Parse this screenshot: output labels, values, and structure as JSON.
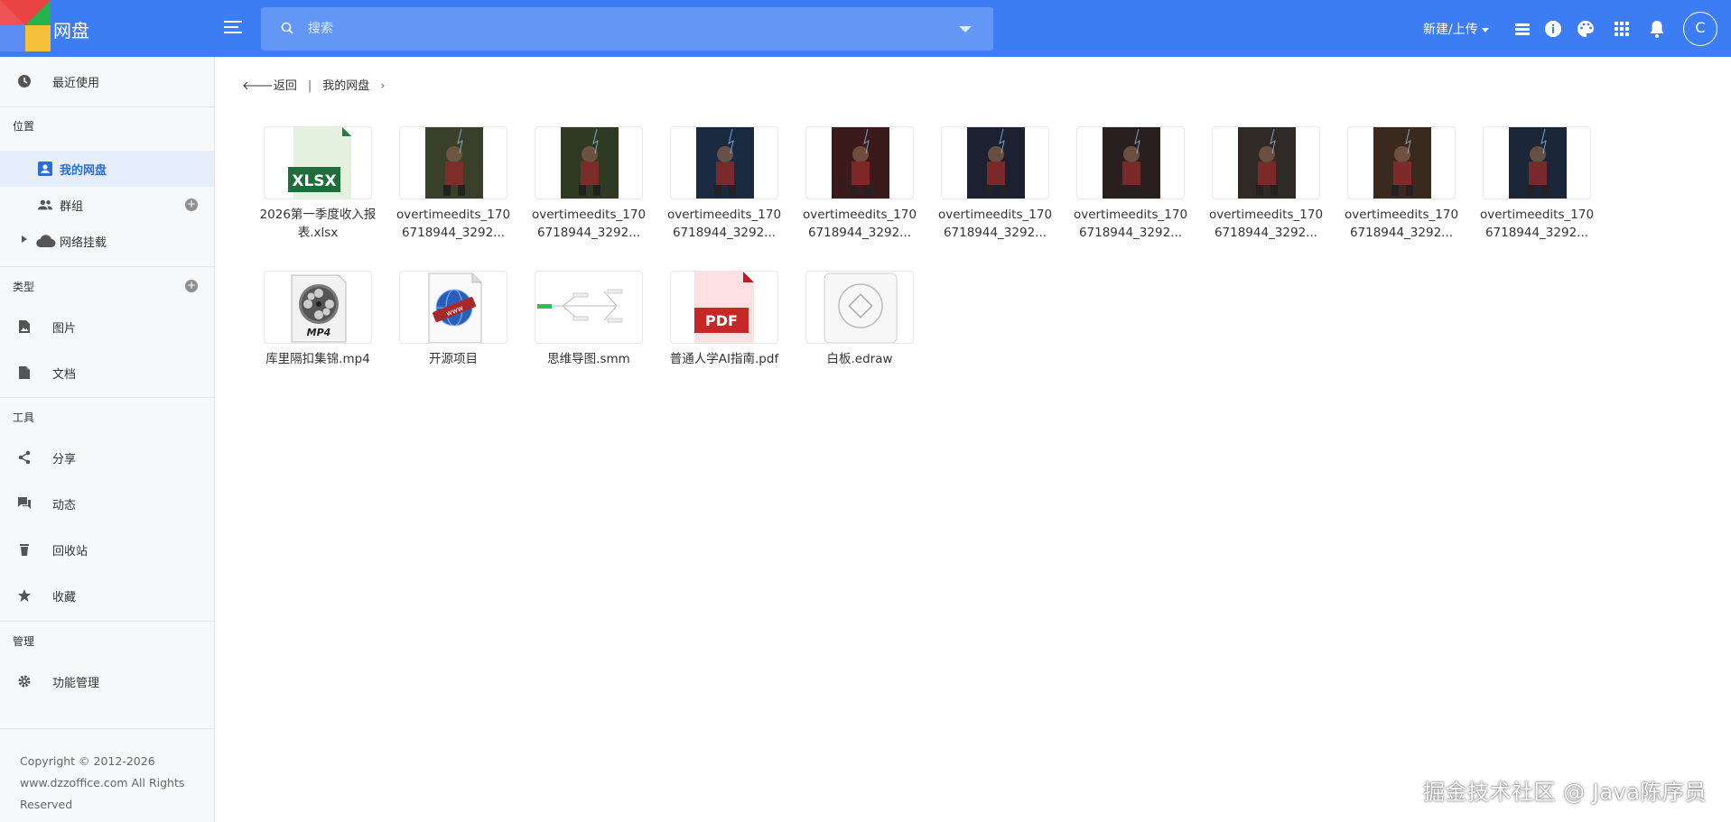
{
  "header": {
    "app_title": "网盘",
    "search_placeholder": "搜索",
    "new_upload_label": "新建/上传",
    "avatar_letter": "C",
    "accent": "#3d7df4"
  },
  "sidebar": {
    "recent": "最近使用",
    "section_location": "位置",
    "my_drive": "我的网盘",
    "groups": "群组",
    "network_mount": "网络挂载",
    "section_type": "类型",
    "images": "图片",
    "documents": "文档",
    "section_tools": "工具",
    "share": "分享",
    "activity": "动态",
    "recycle": "回收站",
    "favorites": "收藏",
    "section_admin": "管理",
    "feature_mgmt": "功能管理",
    "copyright": "Copyright © 2012-2026 www.dzzoffice.com All Rights Reserved"
  },
  "breadcrumb": {
    "back": "返回",
    "sep": "|",
    "current": "我的网盘"
  },
  "files": [
    {
      "name": "2026第一季度收入报表.xlsx",
      "type": "xlsx"
    },
    {
      "name": "overtimeedits_1706718944_3292...",
      "type": "image",
      "color": "#3a3f2a"
    },
    {
      "name": "overtimeedits_1706718944_3292...",
      "type": "image",
      "color": "#2e3a22"
    },
    {
      "name": "overtimeedits_1706718944_3292...",
      "type": "image",
      "color": "#1a2a40"
    },
    {
      "name": "overtimeedits_1706718944_3292...",
      "type": "image",
      "color": "#3a1a1a"
    },
    {
      "name": "overtimeedits_1706718944_3292...",
      "type": "image",
      "color": "#1d2030"
    },
    {
      "name": "overtimeedits_1706718944_3292...",
      "type": "image",
      "color": "#2a1f1f"
    },
    {
      "name": "overtimeedits_1706718944_3292...",
      "type": "image",
      "color": "#2f2a26"
    },
    {
      "name": "overtimeedits_1706718944_3292...",
      "type": "image",
      "color": "#3a2a1e"
    },
    {
      "name": "overtimeedits_1706718944_3292...",
      "type": "image",
      "color": "#1b2638"
    },
    {
      "name": "库里隔扣集锦.mp4",
      "type": "mp4"
    },
    {
      "name": "开源项目",
      "type": "link"
    },
    {
      "name": "思维导图.smm",
      "type": "mindmap"
    },
    {
      "name": "普通人学AI指南.pdf",
      "type": "pdf"
    },
    {
      "name": "白板.edraw",
      "type": "edraw"
    }
  ],
  "thumb_labels": {
    "xlsx": "XLSX",
    "pdf": "PDF",
    "mp4": "MP4",
    "www": "www"
  },
  "watermark": "掘金技术社区 @ Java陈序员"
}
